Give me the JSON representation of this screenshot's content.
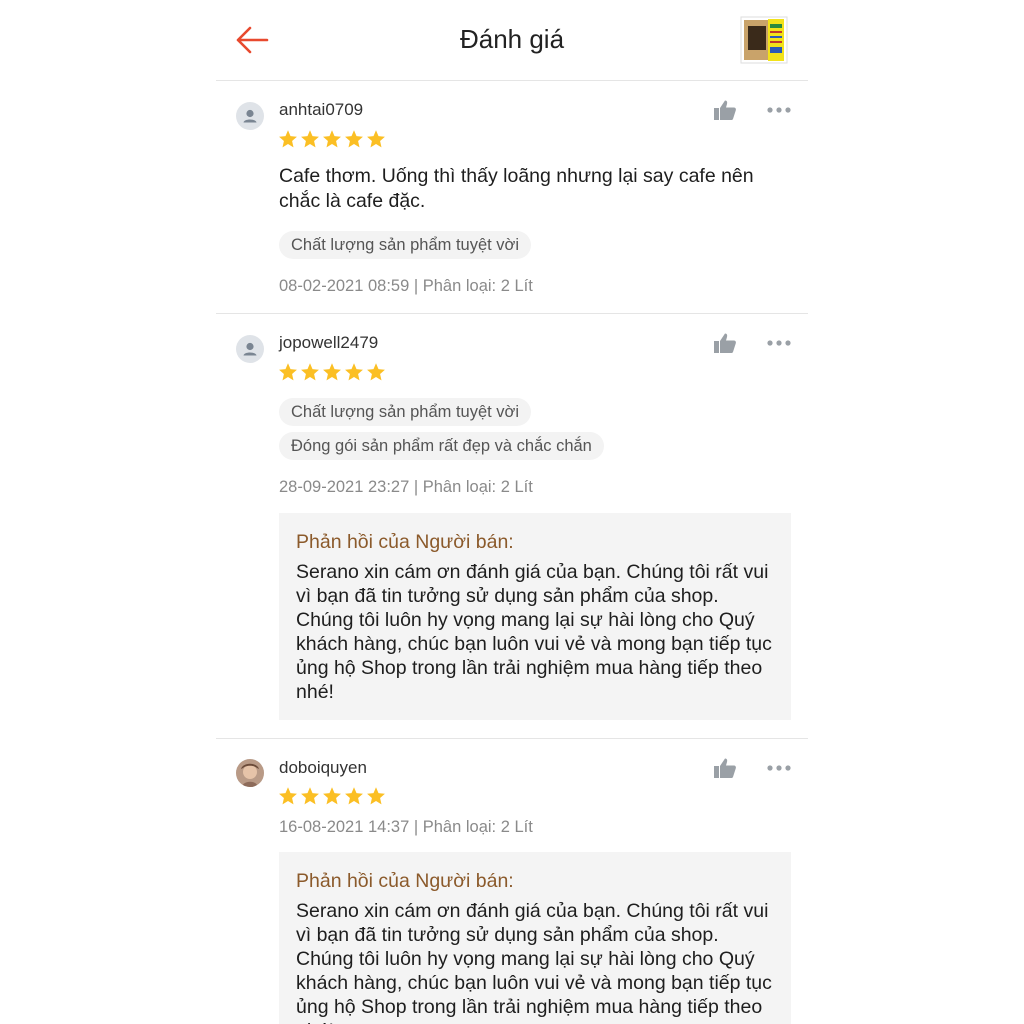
{
  "header": {
    "title": "Đánh giá",
    "back_icon": "arrow-left-icon",
    "accent": "#e8492e",
    "product_thumb_icon": "product-thumbnail"
  },
  "reviews": [
    {
      "username": "anhtai0709",
      "rating": 5,
      "comment": "Cafe thơm. Uống thì thấy loãng nhưng lại say cafe nên chắc là cafe đặc.",
      "tags": [
        "Chất lượng sản phẩm tuyệt vời"
      ],
      "meta": "08-02-2021 08:59 | Phân loại: 2 Lít"
    },
    {
      "username": "jopowell2479",
      "rating": 5,
      "tags": [
        "Chất lượng sản phẩm tuyệt vời",
        "Đóng gói sản phẩm rất đẹp và chắc chắn"
      ],
      "meta": "28-09-2021 23:27 | Phân loại: 2 Lít",
      "reply": {
        "title": "Phản hồi của Người bán:",
        "text": "Serano xin cám ơn đánh giá của bạn. Chúng tôi rất vui vì bạn đã tin tưởng sử dụng sản phẩm của shop. Chúng tôi luôn hy vọng mang lại sự hài lòng cho Quý khách hàng, chúc bạn luôn vui vẻ và mong bạn tiếp tục ủng hộ Shop trong lần trải nghiệm mua hàng tiếp theo nhé!"
      }
    },
    {
      "username": "doboiquyen",
      "rating": 5,
      "meta": "16-08-2021 14:37 | Phân loại: 2 Lít",
      "reply": {
        "title": "Phản hồi của Người bán:",
        "text": "Serano xin cám ơn đánh giá của bạn. Chúng tôi rất vui vì bạn đã tin tưởng sử dụng sản phẩm của shop. Chúng tôi luôn hy vọng mang lại sự hài lòng cho Quý khách hàng, chúc bạn luôn vui vẻ và mong bạn tiếp tục ủng hộ Shop trong lần trải nghiệm mua hàng tiếp theo nhé!"
      }
    }
  ],
  "colors": {
    "star": "#fbbf24",
    "reply_title": "#8b5a2b",
    "icon_gray": "#9aa0a6"
  }
}
